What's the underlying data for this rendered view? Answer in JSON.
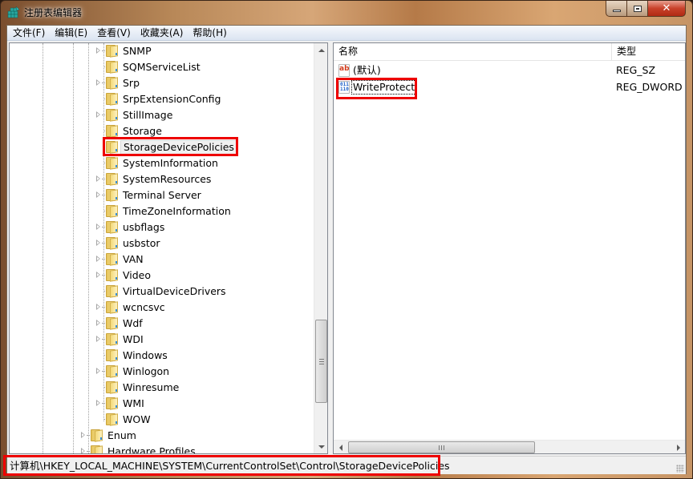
{
  "window": {
    "title": "注册表编辑器",
    "icon": "regedit-icon",
    "controls": {
      "minimize": "minimize",
      "maximize": "maximize",
      "close": "✕"
    }
  },
  "menu": [
    {
      "label": "文件(F)"
    },
    {
      "label": "编辑(E)"
    },
    {
      "label": "查看(V)"
    },
    {
      "label": "收藏夹(A)"
    },
    {
      "label": "帮助(H)"
    }
  ],
  "tree": {
    "items": [
      {
        "label": "SNMP",
        "expandable": true,
        "level": 4
      },
      {
        "label": "SQMServiceList",
        "expandable": false,
        "level": 4
      },
      {
        "label": "Srp",
        "expandable": true,
        "level": 4
      },
      {
        "label": "SrpExtensionConfig",
        "expandable": false,
        "level": 4
      },
      {
        "label": "StillImage",
        "expandable": true,
        "level": 4
      },
      {
        "label": "Storage",
        "expandable": false,
        "level": 4
      },
      {
        "label": "StorageDevicePolicies",
        "expandable": false,
        "level": 4,
        "selected": true,
        "highlighted": true
      },
      {
        "label": "SystemInformation",
        "expandable": false,
        "level": 4
      },
      {
        "label": "SystemResources",
        "expandable": true,
        "level": 4
      },
      {
        "label": "Terminal Server",
        "expandable": true,
        "level": 4
      },
      {
        "label": "TimeZoneInformation",
        "expandable": false,
        "level": 4
      },
      {
        "label": "usbflags",
        "expandable": true,
        "level": 4
      },
      {
        "label": "usbstor",
        "expandable": true,
        "level": 4
      },
      {
        "label": "VAN",
        "expandable": true,
        "level": 4
      },
      {
        "label": "Video",
        "expandable": true,
        "level": 4
      },
      {
        "label": "VirtualDeviceDrivers",
        "expandable": false,
        "level": 4
      },
      {
        "label": "wcncsvc",
        "expandable": true,
        "level": 4
      },
      {
        "label": "Wdf",
        "expandable": true,
        "level": 4
      },
      {
        "label": "WDI",
        "expandable": true,
        "level": 4
      },
      {
        "label": "Windows",
        "expandable": false,
        "level": 4
      },
      {
        "label": "Winlogon",
        "expandable": true,
        "level": 4
      },
      {
        "label": "Winresume",
        "expandable": false,
        "level": 4
      },
      {
        "label": "WMI",
        "expandable": true,
        "level": 4
      },
      {
        "label": "WOW",
        "expandable": false,
        "level": 4,
        "last": true
      },
      {
        "label": "Enum",
        "expandable": true,
        "level": 3
      },
      {
        "label": "Hardware Profiles",
        "expandable": true,
        "level": 3
      }
    ]
  },
  "list": {
    "columns": [
      {
        "label": "名称"
      },
      {
        "label": "类型"
      }
    ],
    "rows": [
      {
        "name": "(默认)",
        "type": "REG_SZ",
        "icon": "string-value-icon",
        "icon_text": "ab"
      },
      {
        "name": "WriteProtect",
        "type": "REG_DWORD",
        "icon": "binary-value-icon",
        "icon_text": "011\n110",
        "focused": true,
        "highlighted": true
      }
    ]
  },
  "statusbar": {
    "path": "计算机\\HKEY_LOCAL_MACHINE\\SYSTEM\\CurrentControlSet\\Control\\StorageDevicePolicies"
  },
  "colors": {
    "highlight_box": "#ee0000",
    "close_button": "#c8412a",
    "menubar_bg": "#dbe4f1"
  }
}
